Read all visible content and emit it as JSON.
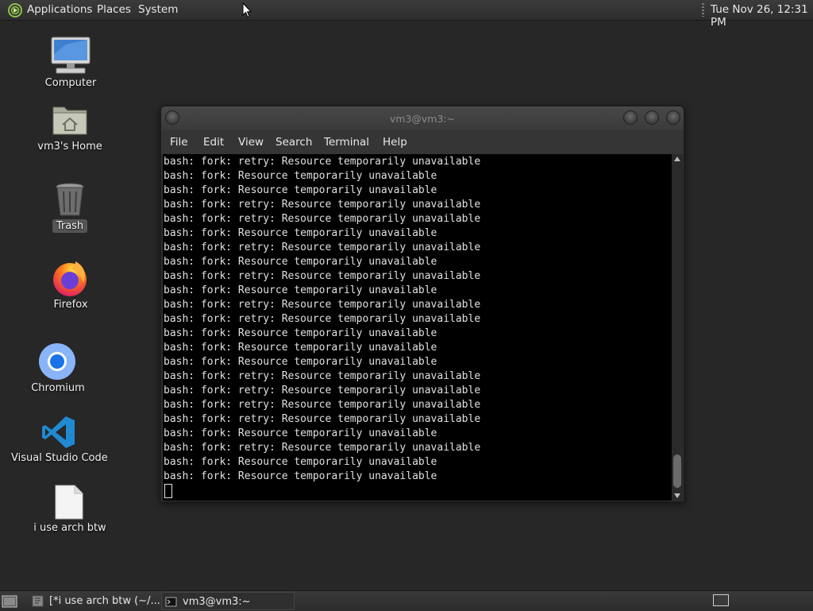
{
  "top_panel": {
    "menus": [
      "Applications",
      "Places",
      "System"
    ],
    "clock": "Tue Nov 26, 12:31 PM"
  },
  "desktop_icons": [
    {
      "label": "Computer",
      "icon": "computer-icon"
    },
    {
      "label": "vm3's Home",
      "icon": "home-folder-icon"
    },
    {
      "label": "Trash",
      "icon": "trash-icon"
    },
    {
      "label": "Firefox",
      "icon": "firefox-icon"
    },
    {
      "label": "Chromium",
      "icon": "chromium-icon"
    },
    {
      "label": "Visual Studio Code",
      "icon": "vscode-icon"
    },
    {
      "label": "i use arch btw",
      "icon": "text-file-icon"
    }
  ],
  "terminal": {
    "title": "vm3@vm3:~",
    "menu": [
      "File",
      "Edit",
      "View",
      "Search",
      "Terminal",
      "Help"
    ],
    "lines": [
      "bash: fork: retry: Resource temporarily unavailable",
      "bash: fork: Resource temporarily unavailable",
      "bash: fork: Resource temporarily unavailable",
      "bash: fork: retry: Resource temporarily unavailable",
      "bash: fork: retry: Resource temporarily unavailable",
      "bash: fork: Resource temporarily unavailable",
      "bash: fork: retry: Resource temporarily unavailable",
      "bash: fork: Resource temporarily unavailable",
      "bash: fork: retry: Resource temporarily unavailable",
      "bash: fork: Resource temporarily unavailable",
      "bash: fork: retry: Resource temporarily unavailable",
      "bash: fork: retry: Resource temporarily unavailable",
      "bash: fork: Resource temporarily unavailable",
      "bash: fork: Resource temporarily unavailable",
      "bash: fork: Resource temporarily unavailable",
      "bash: fork: retry: Resource temporarily unavailable",
      "bash: fork: retry: Resource temporarily unavailable",
      "bash: fork: retry: Resource temporarily unavailable",
      "bash: fork: retry: Resource temporarily unavailable",
      "bash: fork: Resource temporarily unavailable",
      "bash: fork: retry: Resource temporarily unavailable",
      "bash: fork: Resource temporarily unavailable",
      "bash: fork: Resource temporarily unavailable"
    ]
  },
  "taskbar": {
    "tasks": [
      {
        "label": "[*i use arch btw (~/...",
        "icon": "text-editor-icon"
      },
      {
        "label": "vm3@vm3:~",
        "icon": "terminal-icon"
      }
    ]
  }
}
